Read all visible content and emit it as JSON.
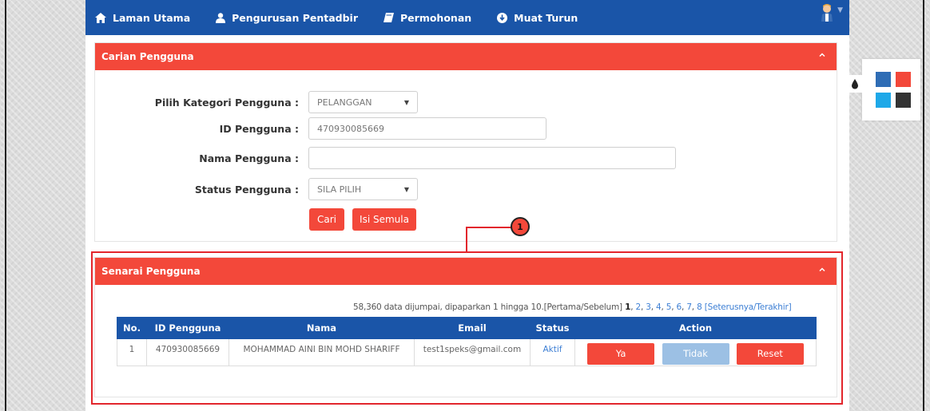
{
  "navbar": {
    "items": [
      {
        "label": "Laman Utama",
        "icon": "home-icon"
      },
      {
        "label": "Pengurusan Pentadbir",
        "icon": "user-icon"
      },
      {
        "label": "Permohonan",
        "icon": "book-icon"
      },
      {
        "label": "Muat Turun",
        "icon": "download-circle-icon"
      }
    ],
    "avatar_icon": "user-avatar-icon",
    "color": "#1a55a8"
  },
  "search_panel": {
    "title": "Carian Pengguna",
    "fields": {
      "category_label": "Pilih Kategori Pengguna :",
      "category_value": "PELANGGAN",
      "id_label": "ID Pengguna :",
      "id_value": "470930085669",
      "name_label": "Nama Pengguna :",
      "name_value": "",
      "status_label": "Status Pengguna :",
      "status_value": "SILA PILIH"
    },
    "buttons": {
      "search": "Cari",
      "reset": "Isi Semula"
    }
  },
  "list_panel": {
    "title": "Senarai Pengguna",
    "summary": "58,360 data dijumpai, dipaparkan 1 hingga 10.",
    "first_prev": "[Pertama/Sebelum]",
    "current_page": "1",
    "pages": [
      "2",
      "3",
      "4",
      "5",
      "6",
      "7",
      "8"
    ],
    "next_last": "[Seterusnya/Terakhir]",
    "columns": [
      "No.",
      "ID Pengguna",
      "Nama",
      "Email",
      "Status",
      "Action"
    ],
    "rows": [
      {
        "no": "1",
        "id": "470930085669",
        "name": "MOHAMMAD AINI BIN MOHD SHARIFF",
        "email": "test1speks@gmail.com",
        "status": "Aktif"
      }
    ],
    "actions": {
      "yes": "Ya",
      "no": "Tidak",
      "reset": "Reset"
    }
  },
  "annotation": {
    "number": "1",
    "color": "#e2262c"
  },
  "theme": {
    "swatches": [
      "#2f6db5",
      "#f3483a",
      "#1ea8e8",
      "#333333"
    ]
  },
  "colors": {
    "accent": "#f3483a",
    "primary": "#1a55a8",
    "disabled": "#9cc0e4"
  }
}
